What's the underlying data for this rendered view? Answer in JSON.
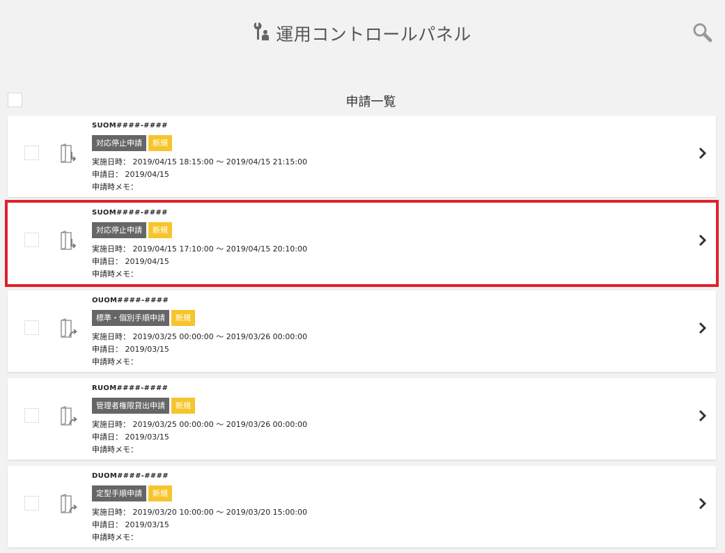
{
  "header": {
    "title": "運用コントロールパネル"
  },
  "list": {
    "title": "申請一覧"
  },
  "labels": {
    "exec_label": "実施日時：",
    "apply_label": "申請日：",
    "memo_label": "申請時メモ："
  },
  "items": [
    {
      "code": "SUOM####-####",
      "type": "対応停止申請",
      "status": "新規",
      "exec": "2019/04/15 18:15:00 ～ 2019/04/15 21:15:00",
      "applied": "2019/04/15",
      "memo": "",
      "icon": "document-return-icon",
      "highlighted": false
    },
    {
      "code": "SUOM####-####",
      "type": "対応停止申請",
      "status": "新規",
      "exec": "2019/04/15 17:10:00 ～ 2019/04/15 20:10:00",
      "applied": "2019/04/15",
      "memo": "",
      "icon": "document-return-icon",
      "highlighted": true
    },
    {
      "code": "OUOM####-####",
      "type": "標準・個別手順申請",
      "status": "新規",
      "exec": "2019/03/25 00:00:00 ～ 2019/03/26 00:00:00",
      "applied": "2019/03/15",
      "memo": "",
      "icon": "document-forward-icon",
      "highlighted": false
    },
    {
      "code": "RUOM####-####",
      "type": "管理者権限貸出申請",
      "status": "新規",
      "exec": "2019/03/25 00:00:00 ～ 2019/03/26 00:00:00",
      "applied": "2019/03/15",
      "memo": "",
      "icon": "document-forward-icon",
      "highlighted": false
    },
    {
      "code": "DUOM####-####",
      "type": "定型手順申請",
      "status": "新規",
      "exec": "2019/03/20 10:00:00 ～ 2019/03/20 15:00:00",
      "applied": "2019/03/15",
      "memo": "",
      "icon": "document-forward-icon",
      "highlighted": false
    }
  ],
  "colors": {
    "background": "#f2f2f2",
    "tag_type": "#666666",
    "tag_new": "#f7c52b",
    "highlight": "#e0202a"
  }
}
